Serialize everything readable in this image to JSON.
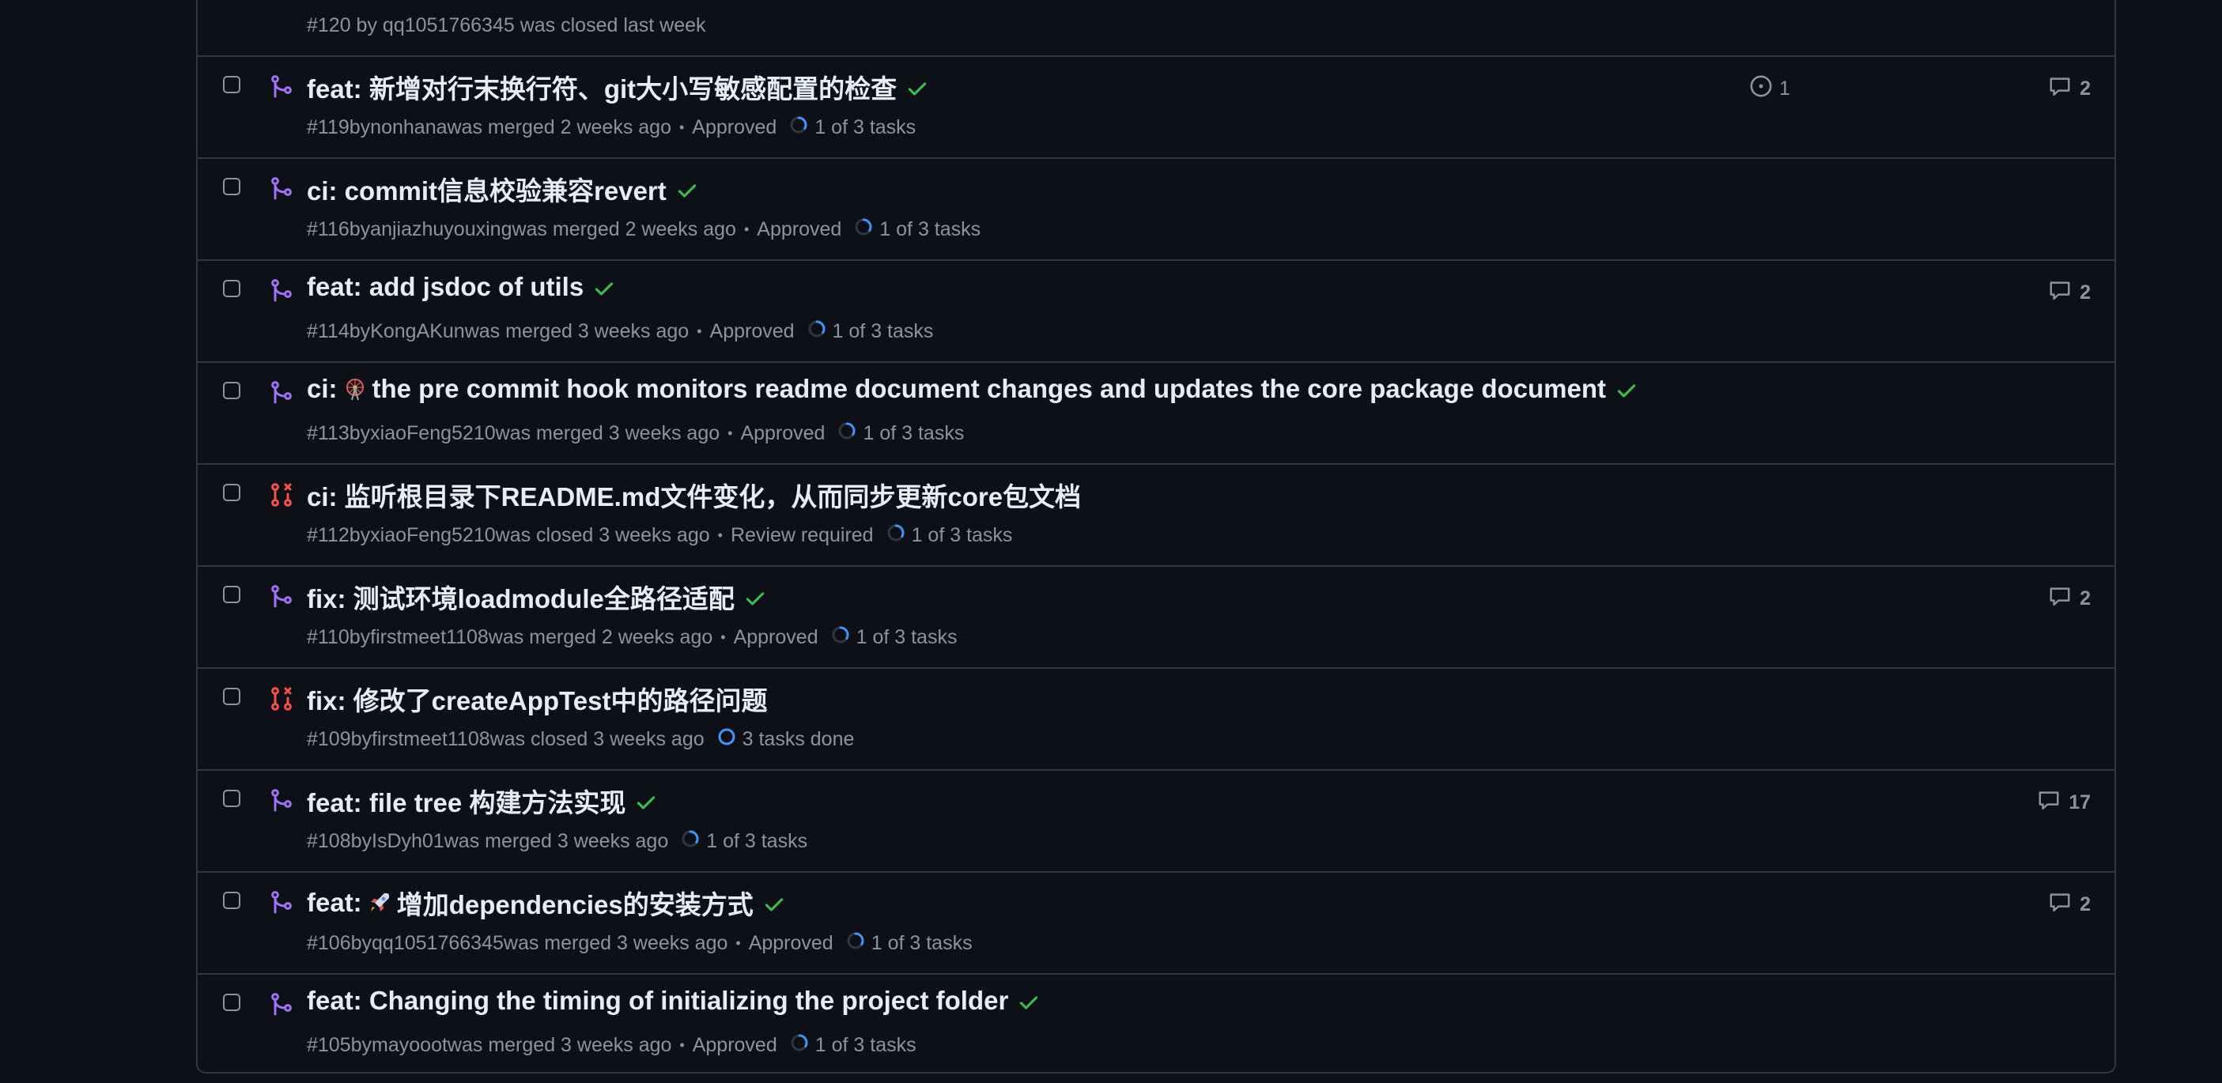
{
  "colors": {
    "background": "#0d1117",
    "border": "#30363d",
    "merged": "#a371f7",
    "closed": "#f85149",
    "check": "#3fb950",
    "muted": "#8b949e",
    "text": "#e6edf3",
    "progress": "#4493f8"
  },
  "partial_row": {
    "meta": "#120 by qq1051766345 was closed last week"
  },
  "pulls": [
    {
      "state_icon": "merged-pr-icon",
      "title": "feat: 新增对行末换行符、git大小写敏感配置的检查",
      "check": true,
      "number": "#119",
      "by": "by",
      "author": "nonhana",
      "status": "was merged 2 weeks ago",
      "review": "Approved",
      "tasks": "1 of 3 tasks",
      "tasks_progress": 0.333,
      "linked_issues": "1",
      "comments": "2"
    },
    {
      "state_icon": "merged-pr-icon",
      "title": "ci: commit信息校验兼容revert",
      "check": true,
      "number": "#116",
      "by": "by",
      "author": "anjiazhuyouxing",
      "status": "was merged 2 weeks ago",
      "review": "Approved",
      "tasks": "1 of 3 tasks",
      "tasks_progress": 0.333,
      "linked_issues": "",
      "comments": ""
    },
    {
      "state_icon": "merged-pr-icon",
      "title": "feat: add jsdoc of utils",
      "check": true,
      "number": "#114",
      "by": "by",
      "author": "KongAKun",
      "status": "was merged 3 weeks ago",
      "review": "Approved",
      "tasks": "1 of 3 tasks",
      "tasks_progress": 0.333,
      "linked_issues": "",
      "comments": "2"
    },
    {
      "state_icon": "merged-pr-icon",
      "title_prefix": "ci:",
      "title_emoji": "ferris-wheel-emoji",
      "title": "the pre commit hook monitors readme document changes and updates the core package document",
      "check": true,
      "number": "#113",
      "by": "by",
      "author": "xiaoFeng5210",
      "status": "was merged 3 weeks ago",
      "review": "Approved",
      "tasks": "1 of 3 tasks",
      "tasks_progress": 0.333,
      "linked_issues": "",
      "comments": ""
    },
    {
      "state_icon": "closed-pr-icon",
      "title": "ci: 监听根目录下README.md文件变化，从而同步更新core包文档",
      "check": false,
      "number": "#112",
      "by": "by",
      "author": "xiaoFeng5210",
      "status": "was closed 3 weeks ago",
      "review": "Review required",
      "tasks": "1 of 3 tasks",
      "tasks_progress": 0.333,
      "linked_issues": "",
      "comments": ""
    },
    {
      "state_icon": "merged-pr-icon",
      "title": "fix: 测试环境loadmodule全路径适配",
      "check": true,
      "number": "#110",
      "by": "by",
      "author": "firstmeet1108",
      "status": "was merged 2 weeks ago",
      "review": "Approved",
      "tasks": "1 of 3 tasks",
      "tasks_progress": 0.333,
      "linked_issues": "",
      "comments": "2"
    },
    {
      "state_icon": "closed-pr-icon",
      "title": "fix: 修改了createAppTest中的路径问题",
      "check": false,
      "number": "#109",
      "by": "by",
      "author": "firstmeet1108",
      "status": "was closed 3 weeks ago",
      "review": "",
      "tasks": "3 tasks done",
      "tasks_progress": 1.0,
      "linked_issues": "",
      "comments": ""
    },
    {
      "state_icon": "merged-pr-icon",
      "title": "feat: file tree 构建方法实现",
      "check": true,
      "number": "#108",
      "by": "by",
      "author": "IsDyh01",
      "status": "was merged 3 weeks ago",
      "review": "",
      "tasks": "1 of 3 tasks",
      "tasks_progress": 0.333,
      "linked_issues": "",
      "comments": "17"
    },
    {
      "state_icon": "merged-pr-icon",
      "title_prefix": "feat:",
      "title_emoji": "rocket-emoji",
      "title": "增加dependencies的安装方式",
      "check": true,
      "number": "#106",
      "by": "by",
      "author": "qq1051766345",
      "status": "was merged 3 weeks ago",
      "review": "Approved",
      "tasks": "1 of 3 tasks",
      "tasks_progress": 0.333,
      "linked_issues": "",
      "comments": "2"
    },
    {
      "state_icon": "merged-pr-icon",
      "title": "feat: Changing the timing of initializing the project folder",
      "check": true,
      "number": "#105",
      "by": "by",
      "author": "mayooot",
      "status": "was merged 3 weeks ago",
      "review": "Approved",
      "tasks": "1 of 3 tasks",
      "tasks_progress": 0.333,
      "linked_issues": "",
      "comments": ""
    }
  ]
}
